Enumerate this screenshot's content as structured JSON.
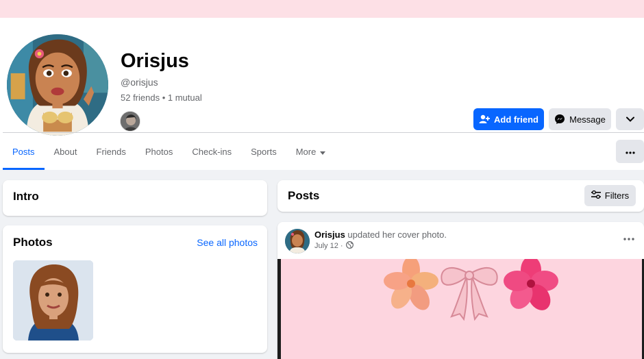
{
  "profile": {
    "name": "Orisjus",
    "handle": "@orisjus",
    "friends_line": "52 friends • 1 mutual"
  },
  "actions": {
    "add_friend": "Add friend",
    "message": "Message"
  },
  "tabs": [
    {
      "label": "Posts",
      "active": true
    },
    {
      "label": "About"
    },
    {
      "label": "Friends"
    },
    {
      "label": "Photos"
    },
    {
      "label": "Check-ins"
    },
    {
      "label": "Sports"
    },
    {
      "label": "More"
    }
  ],
  "intro": {
    "title": "Intro"
  },
  "photos": {
    "title": "Photos",
    "see_all": "See all photos"
  },
  "posts": {
    "title": "Posts",
    "filters": "Filters"
  },
  "post": {
    "author": "Orisjus",
    "action": "updated her cover photo.",
    "date": "July 12 ·"
  },
  "colors": {
    "accent": "#0866ff",
    "cover_pink": "#fde0e6",
    "button_gray": "#e4e6eb",
    "page_bg": "#f0f2f5"
  },
  "icons": {
    "add_friend": "person-plus-icon",
    "message": "messenger-icon",
    "chevron": "chevron-down-icon",
    "more": "more-dots-icon",
    "filters": "sliders-icon",
    "privacy": "globe-icon"
  }
}
